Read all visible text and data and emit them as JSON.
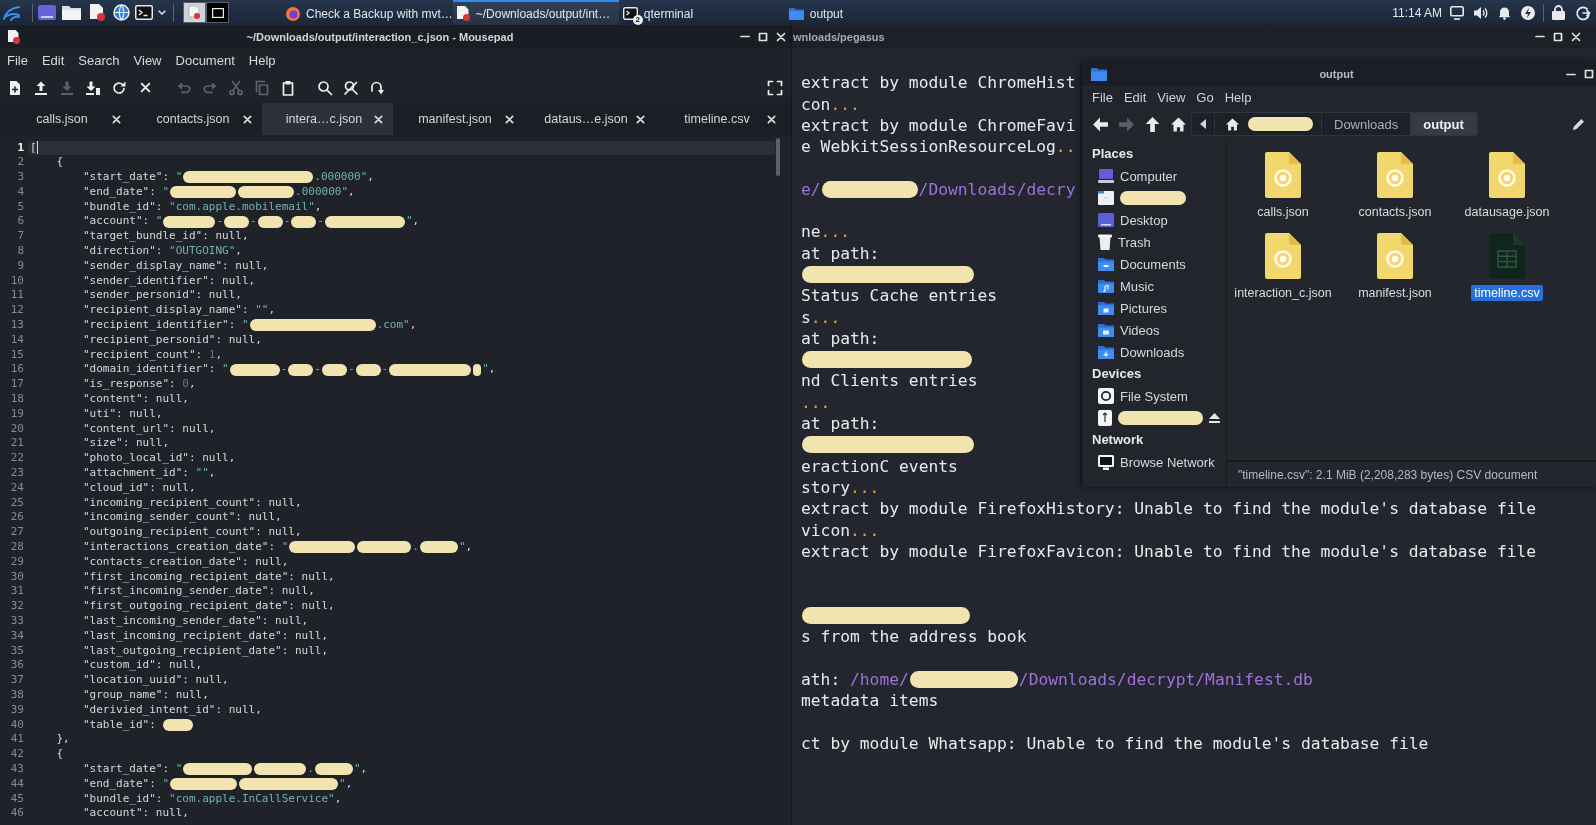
{
  "taskbar": {
    "workspaces": [
      {
        "selected": true
      },
      {
        "selected": false
      }
    ],
    "tasks": [
      {
        "kind": "browser",
        "label": "Check a Backup with mvt…",
        "selected": false
      },
      {
        "kind": "editor",
        "label": "~/Downloads/output/int…",
        "selected": true
      },
      {
        "kind": "terminal",
        "label": "qterminal",
        "badge": "2",
        "selected": false
      },
      {
        "kind": "files",
        "label": "output",
        "selected": false
      }
    ],
    "clock": "11:14 AM"
  },
  "editor_window": {
    "title": "~/Downloads/output/interaction_c.json - Mousepad",
    "menu": [
      "File",
      "Edit",
      "Search",
      "View",
      "Document",
      "Help"
    ],
    "toolbar": [
      [
        {
          "kind": "new",
          "disabled": false
        },
        {
          "kind": "open",
          "disabled": false
        },
        {
          "kind": "save",
          "disabled": true
        },
        {
          "kind": "save-as",
          "disabled": false
        },
        {
          "kind": "reload",
          "disabled": false
        },
        {
          "kind": "close",
          "disabled": false
        }
      ],
      [
        {
          "kind": "undo",
          "disabled": true
        },
        {
          "kind": "redo",
          "disabled": true
        }
      ],
      [
        {
          "kind": "cut",
          "disabled": true
        },
        {
          "kind": "copy",
          "disabled": true
        },
        {
          "kind": "paste",
          "disabled": false
        }
      ],
      [
        {
          "kind": "find",
          "disabled": false
        },
        {
          "kind": "replace",
          "disabled": false
        },
        {
          "kind": "goto",
          "disabled": false
        }
      ],
      [
        {
          "kind": "fullscreen",
          "disabled": false
        }
      ]
    ],
    "tabs": [
      {
        "label": "calls.json",
        "selected": false
      },
      {
        "label": "contacts.json",
        "selected": false
      },
      {
        "label": "intera…c.json",
        "selected": true
      },
      {
        "label": "manifest.json",
        "selected": false
      },
      {
        "label": "dataus…e.json",
        "selected": false
      },
      {
        "label": "timeline.csv",
        "selected": false
      }
    ],
    "lines": [
      {
        "number": "1",
        "current": true,
        "segments": [
          {
            "kind": "plain",
            "text": "["
          }
        ],
        "children": [
          {
            "number": "2",
            "current": false,
            "segments": [
              {
                "kind": "plain",
                "text": "{"
              }
            ],
            "children": [
              {
                "number": "3",
                "current": false,
                "segments": [
                  {
                    "kind": "plain",
                    "text": "\"start_date\": "
                  },
                  {
                    "kind": "string",
                    "text": "\""
                  },
                  {
                    "kind": "redacted"
                  },
                  {
                    "kind": "string",
                    "text": ".000000\""
                  },
                  {
                    "kind": "plain",
                    "text": ","
                  }
                ]
              },
              {
                "number": "4",
                "current": false,
                "segments": [
                  {
                    "kind": "plain",
                    "text": "\"end_date\": "
                  },
                  {
                    "kind": "string",
                    "text": "\""
                  },
                  {
                    "kind": "redacted"
                  },
                  {
                    "kind": "redacted"
                  },
                  {
                    "kind": "string",
                    "text": ".000000\""
                  },
                  {
                    "kind": "plain",
                    "text": ","
                  }
                ]
              },
              {
                "number": "5",
                "current": false,
                "segments": [
                  {
                    "kind": "plain",
                    "text": "\"bundle_id\": "
                  },
                  {
                    "kind": "string",
                    "text": "\"com.apple.mobilemail\""
                  },
                  {
                    "kind": "plain",
                    "text": ","
                  }
                ]
              },
              {
                "number": "6",
                "current": false,
                "segments": [
                  {
                    "kind": "plain",
                    "text": "\"account\": "
                  },
                  {
                    "kind": "string",
                    "text": "\""
                  },
                  {
                    "kind": "redacted"
                  },
                  {
                    "kind": "string",
                    "text": "-"
                  },
                  {
                    "kind": "redacted"
                  },
                  {
                    "kind": "string",
                    "text": "-"
                  },
                  {
                    "kind": "redacted"
                  },
                  {
                    "kind": "string",
                    "text": "-"
                  },
                  {
                    "kind": "redacted"
                  },
                  {
                    "kind": "string",
                    "text": "-"
                  },
                  {
                    "kind": "redacted"
                  },
                  {
                    "kind": "string",
                    "text": "\""
                  },
                  {
                    "kind": "plain",
                    "text": ","
                  }
                ]
              },
              {
                "number": "7",
                "current": false,
                "segments": [
                  {
                    "kind": "plain",
                    "text": "\"target_bundle_id\": null,"
                  }
                ]
              },
              {
                "number": "8",
                "current": false,
                "segments": [
                  {
                    "kind": "plain",
                    "text": "\"direction\": "
                  },
                  {
                    "kind": "string",
                    "text": "\"OUTGOING\""
                  },
                  {
                    "kind": "plain",
                    "text": ","
                  }
                ]
              },
              {
                "number": "9",
                "current": false,
                "segments": [
                  {
                    "kind": "plain",
                    "text": "\"sender_display_name\": null,"
                  }
                ]
              },
              {
                "number": "10",
                "current": false,
                "segments": [
                  {
                    "kind": "plain",
                    "text": "\"sender_identifier\": null,"
                  }
                ]
              },
              {
                "number": "11",
                "current": false,
                "segments": [
                  {
                    "kind": "plain",
                    "text": "\"sender_personid\": null,"
                  }
                ]
              },
              {
                "number": "12",
                "current": false,
                "segments": [
                  {
                    "kind": "plain",
                    "text": "\"recipient_display_name\": "
                  },
                  {
                    "kind": "string",
                    "text": "\"\""
                  },
                  {
                    "kind": "plain",
                    "text": ","
                  }
                ]
              },
              {
                "number": "13",
                "current": false,
                "segments": [
                  {
                    "kind": "plain",
                    "text": "\"recipient_identifier\": "
                  },
                  {
                    "kind": "string",
                    "text": "\""
                  },
                  {
                    "kind": "redacted"
                  },
                  {
                    "kind": "string",
                    "text": ".com\""
                  },
                  {
                    "kind": "plain",
                    "text": ","
                  }
                ]
              },
              {
                "number": "14",
                "current": false,
                "segments": [
                  {
                    "kind": "plain",
                    "text": "\"recipient_personid\": null,"
                  }
                ]
              },
              {
                "number": "15",
                "current": false,
                "segments": [
                  {
                    "kind": "plain",
                    "text": "\"recipient_count\": "
                  },
                  {
                    "kind": "number",
                    "text": "1"
                  },
                  {
                    "kind": "plain",
                    "text": ","
                  }
                ]
              },
              {
                "number": "16",
                "current": false,
                "segments": [
                  {
                    "kind": "plain",
                    "text": "\"domain_identifier\": "
                  },
                  {
                    "kind": "string",
                    "text": "\""
                  },
                  {
                    "kind": "redacted"
                  },
                  {
                    "kind": "string",
                    "text": "-"
                  },
                  {
                    "kind": "redacted"
                  },
                  {
                    "kind": "string",
                    "text": "-"
                  },
                  {
                    "kind": "redacted"
                  },
                  {
                    "kind": "string",
                    "text": "-"
                  },
                  {
                    "kind": "redacted"
                  },
                  {
                    "kind": "string",
                    "text": "-"
                  },
                  {
                    "kind": "redacted"
                  },
                  {
                    "kind": "redacted"
                  },
                  {
                    "kind": "string",
                    "text": "\""
                  },
                  {
                    "kind": "plain",
                    "text": ","
                  }
                ]
              },
              {
                "number": "17",
                "current": false,
                "segments": [
                  {
                    "kind": "plain",
                    "text": "\"is_response\": "
                  },
                  {
                    "kind": "number",
                    "text": "0"
                  },
                  {
                    "kind": "plain",
                    "text": ","
                  }
                ]
              },
              {
                "number": "18",
                "current": false,
                "segments": [
                  {
                    "kind": "plain",
                    "text": "\"content\": null,"
                  }
                ]
              },
              {
                "number": "19",
                "current": false,
                "segments": [
                  {
                    "kind": "plain",
                    "text": "\"uti\": null,"
                  }
                ]
              },
              {
                "number": "20",
                "current": false,
                "segments": [
                  {
                    "kind": "plain",
                    "text": "\"content_url\": null,"
                  }
                ]
              },
              {
                "number": "21",
                "current": false,
                "segments": [
                  {
                    "kind": "plain",
                    "text": "\"size\": null,"
                  }
                ]
              },
              {
                "number": "22",
                "current": false,
                "segments": [
                  {
                    "kind": "plain",
                    "text": "\"photo_local_id\": null,"
                  }
                ]
              },
              {
                "number": "23",
                "current": false,
                "segments": [
                  {
                    "kind": "plain",
                    "text": "\"attachment_id\": "
                  },
                  {
                    "kind": "string",
                    "text": "\"\""
                  },
                  {
                    "kind": "plain",
                    "text": ","
                  }
                ]
              },
              {
                "number": "24",
                "current": false,
                "segments": [
                  {
                    "kind": "plain",
                    "text": "\"cloud_id\": null,"
                  }
                ]
              },
              {
                "number": "25",
                "current": false,
                "segments": [
                  {
                    "kind": "plain",
                    "text": "\"incoming_recipient_count\": null,"
                  }
                ]
              },
              {
                "number": "26",
                "current": false,
                "segments": [
                  {
                    "kind": "plain",
                    "text": "\"incoming_sender_count\": null,"
                  }
                ]
              },
              {
                "number": "27",
                "current": false,
                "segments": [
                  {
                    "kind": "plain",
                    "text": "\"outgoing_recipient_count\": null,"
                  }
                ]
              },
              {
                "number": "28",
                "current": false,
                "segments": [
                  {
                    "kind": "plain",
                    "text": "\"interactions_creation_date\": "
                  },
                  {
                    "kind": "string",
                    "text": "\""
                  },
                  {
                    "kind": "redacted"
                  },
                  {
                    "kind": "redacted"
                  },
                  {
                    "kind": "string",
                    "text": "."
                  },
                  {
                    "kind": "redacted"
                  },
                  {
                    "kind": "string",
                    "text": "\""
                  },
                  {
                    "kind": "plain",
                    "text": ","
                  }
                ]
              },
              {
                "number": "29",
                "current": false,
                "segments": [
                  {
                    "kind": "plain",
                    "text": "\"contacts_creation_date\": null,"
                  }
                ]
              },
              {
                "number": "30",
                "current": false,
                "segments": [
                  {
                    "kind": "plain",
                    "text": "\"first_incoming_recipient_date\": null,"
                  }
                ]
              },
              {
                "number": "31",
                "current": false,
                "segments": [
                  {
                    "kind": "plain",
                    "text": "\"first_incoming_sender_date\": null,"
                  }
                ]
              },
              {
                "number": "32",
                "current": false,
                "segments": [
                  {
                    "kind": "plain",
                    "text": "\"first_outgoing_recipient_date\": null,"
                  }
                ]
              },
              {
                "number": "33",
                "current": false,
                "segments": [
                  {
                    "kind": "plain",
                    "text": "\"last_incoming_sender_date\": null,"
                  }
                ]
              },
              {
                "number": "34",
                "current": false,
                "segments": [
                  {
                    "kind": "plain",
                    "text": "\"last_incoming_recipient_date\": null,"
                  }
                ]
              },
              {
                "number": "35",
                "current": false,
                "segments": [
                  {
                    "kind": "plain",
                    "text": "\"last_outgoing_recipient_date\": null,"
                  }
                ]
              },
              {
                "number": "36",
                "current": false,
                "segments": [
                  {
                    "kind": "plain",
                    "text": "\"custom_id\": null,"
                  }
                ]
              },
              {
                "number": "37",
                "current": false,
                "segments": [
                  {
                    "kind": "plain",
                    "text": "\"location_uuid\": null,"
                  }
                ]
              },
              {
                "number": "38",
                "current": false,
                "segments": [
                  {
                    "kind": "plain",
                    "text": "\"group_name\": null,"
                  }
                ]
              },
              {
                "number": "39",
                "current": false,
                "segments": [
                  {
                    "kind": "plain",
                    "text": "\"derivied_intent_id\": null,"
                  }
                ]
              },
              {
                "number": "40",
                "current": false,
                "segments": [
                  {
                    "kind": "plain",
                    "text": "\"table_id\": "
                  },
                  {
                    "kind": "redacted"
                  }
                ]
              }
            ]
          },
          {
            "number": "41",
            "current": false,
            "segments": [
              {
                "kind": "plain",
                "text": "},"
              }
            ]
          },
          {
            "number": "42",
            "current": false,
            "segments": [
              {
                "kind": "plain",
                "text": "{"
              }
            ],
            "children": [
              {
                "number": "43",
                "current": false,
                "segments": [
                  {
                    "kind": "plain",
                    "text": "\"start_date\": "
                  },
                  {
                    "kind": "string",
                    "text": "\""
                  },
                  {
                    "kind": "redacted"
                  },
                  {
                    "kind": "redacted"
                  },
                  {
                    "kind": "string",
                    "text": "."
                  },
                  {
                    "kind": "redacted"
                  },
                  {
                    "kind": "string",
                    "text": "\""
                  },
                  {
                    "kind": "plain",
                    "text": ","
                  }
                ]
              },
              {
                "number": "44",
                "current": false,
                "segments": [
                  {
                    "kind": "plain",
                    "text": "\"end_date\": "
                  },
                  {
                    "kind": "string",
                    "text": "\""
                  },
                  {
                    "kind": "redacted"
                  },
                  {
                    "kind": "redacted"
                  },
                  {
                    "kind": "string",
                    "text": "\""
                  },
                  {
                    "kind": "plain",
                    "text": ","
                  }
                ]
              },
              {
                "number": "45",
                "current": false,
                "segments": [
                  {
                    "kind": "plain",
                    "text": "\"bundle_id\": "
                  },
                  {
                    "kind": "string",
                    "text": "\"com.apple.InCallService\""
                  },
                  {
                    "kind": "plain",
                    "text": ","
                  }
                ]
              },
              {
                "number": "46",
                "current": false,
                "segments": [
                  {
                    "kind": "plain",
                    "text": "\"account\": null,"
                  }
                ]
              }
            ]
          }
        ]
      }
    ]
  },
  "terminal_window": {
    "title": "wnloads/pegasus",
    "lines": [
      {
        "kind": "text",
        "segments": [
          {
            "kind": "plain",
            "text": "extract by module ChromeHist"
          }
        ]
      },
      {
        "kind": "text",
        "segments": [
          {
            "kind": "plain",
            "text": "con"
          },
          {
            "kind": "dots",
            "text": "..."
          }
        ]
      },
      {
        "kind": "text",
        "segments": [
          {
            "kind": "plain",
            "text": "extract by module ChromeFavi"
          }
        ]
      },
      {
        "kind": "text",
        "segments": [
          {
            "kind": "plain",
            "text": "e WebkitSessionResourceLog"
          },
          {
            "kind": "dots",
            "text": ".."
          }
        ]
      },
      {
        "kind": "blank"
      },
      {
        "kind": "text",
        "segments": [
          {
            "kind": "path",
            "text": "e/"
          },
          {
            "kind": "redacted"
          },
          {
            "kind": "path",
            "text": "/Downloads/decry"
          }
        ]
      },
      {
        "kind": "blank"
      },
      {
        "kind": "text",
        "segments": [
          {
            "kind": "plain",
            "text": "ne"
          },
          {
            "kind": "dots",
            "text": "..."
          }
        ]
      },
      {
        "kind": "text",
        "segments": [
          {
            "kind": "plain",
            "text": "at path:"
          }
        ]
      },
      {
        "kind": "text",
        "segments": [
          {
            "kind": "redacted"
          }
        ]
      },
      {
        "kind": "text",
        "segments": [
          {
            "kind": "plain",
            "text": "Status Cache entries"
          }
        ]
      },
      {
        "kind": "text",
        "segments": [
          {
            "kind": "plain",
            "text": "s"
          },
          {
            "kind": "dots",
            "text": "..."
          }
        ]
      },
      {
        "kind": "text",
        "segments": [
          {
            "kind": "plain",
            "text": "at path:"
          }
        ]
      },
      {
        "kind": "text",
        "segments": [
          {
            "kind": "redacted"
          }
        ]
      },
      {
        "kind": "text",
        "segments": [
          {
            "kind": "plain",
            "text": "nd Clients entries"
          }
        ]
      },
      {
        "kind": "text",
        "segments": [
          {
            "kind": "dots",
            "text": "..."
          }
        ]
      },
      {
        "kind": "text",
        "segments": [
          {
            "kind": "plain",
            "text": "at path:"
          }
        ]
      },
      {
        "kind": "text",
        "segments": [
          {
            "kind": "redacted"
          }
        ]
      },
      {
        "kind": "text",
        "segments": [
          {
            "kind": "plain",
            "text": "eractionC events"
          }
        ]
      },
      {
        "kind": "text",
        "segments": [
          {
            "kind": "plain",
            "text": "story"
          },
          {
            "kind": "dots",
            "text": "..."
          }
        ]
      },
      {
        "kind": "text",
        "segments": [
          {
            "kind": "plain",
            "text": "extract by module FirefoxHistory: Unable to find the module's database file"
          }
        ]
      },
      {
        "kind": "text",
        "segments": [
          {
            "kind": "plain",
            "text": "vicon"
          },
          {
            "kind": "dots",
            "text": "..."
          }
        ]
      },
      {
        "kind": "text",
        "segments": [
          {
            "kind": "plain",
            "text": "extract by module FirefoxFavicon: Unable to find the module's database file"
          }
        ]
      },
      {
        "kind": "blank"
      },
      {
        "kind": "blank"
      },
      {
        "kind": "text",
        "segments": [
          {
            "kind": "redacted"
          }
        ]
      },
      {
        "kind": "text",
        "segments": [
          {
            "kind": "plain",
            "text": "s from the address book"
          }
        ]
      },
      {
        "kind": "blank"
      },
      {
        "kind": "text",
        "segments": [
          {
            "kind": "plain",
            "text": "ath: "
          },
          {
            "kind": "path",
            "text": "/home/"
          },
          {
            "kind": "redacted"
          },
          {
            "kind": "path",
            "text": "/Downloads/decrypt/Manifest.db"
          }
        ]
      },
      {
        "kind": "text",
        "segments": [
          {
            "kind": "plain",
            "text": "metadata items"
          }
        ]
      },
      {
        "kind": "blank"
      },
      {
        "kind": "text",
        "segments": [
          {
            "kind": "plain",
            "text": "ct by module Whatsapp: Unable to find the module's database file"
          }
        ]
      }
    ]
  },
  "file_manager": {
    "title": "output",
    "menu": [
      "File",
      "Edit",
      "View",
      "Go",
      "Help"
    ],
    "nav": [
      {
        "kind": "back",
        "disabled": false
      },
      {
        "kind": "forward",
        "disabled": true
      },
      {
        "kind": "up",
        "disabled": false
      },
      {
        "kind": "home",
        "disabled": false
      }
    ],
    "path": [
      {
        "kind": "home",
        "selected": false
      },
      {
        "kind": "folder",
        "label": "Downloads",
        "selected": false
      },
      {
        "kind": "folder",
        "label": "output",
        "selected": true
      }
    ],
    "sidebar": [
      {
        "heading": "Places",
        "items": [
          {
            "kind": "computer",
            "label": "Computer",
            "redacted": false
          },
          {
            "kind": "home",
            "redacted": true
          },
          {
            "kind": "desktop",
            "label": "Desktop",
            "redacted": false
          },
          {
            "kind": "trash",
            "label": "Trash",
            "redacted": false
          },
          {
            "kind": "documents",
            "label": "Documents",
            "redacted": false
          },
          {
            "kind": "music",
            "label": "Music",
            "redacted": false
          },
          {
            "kind": "pictures",
            "label": "Pictures",
            "redacted": false
          },
          {
            "kind": "videos",
            "label": "Videos",
            "redacted": false
          },
          {
            "kind": "downloads",
            "label": "Downloads",
            "redacted": false
          }
        ]
      },
      {
        "heading": "Devices",
        "items": [
          {
            "kind": "filesystem",
            "label": "File System",
            "redacted": false
          },
          {
            "kind": "usb",
            "redacted": true
          }
        ]
      },
      {
        "heading": "Network",
        "items": [
          {
            "kind": "network",
            "label": "Browse Network",
            "redacted": false
          }
        ]
      }
    ],
    "files": [
      {
        "kind": "json",
        "name": "calls.json",
        "selected": false
      },
      {
        "kind": "json",
        "name": "contacts.json",
        "selected": false
      },
      {
        "kind": "json",
        "name": "datausage.json",
        "selected": false
      },
      {
        "kind": "json",
        "name": "interaction_c.json",
        "selected": false
      },
      {
        "kind": "json",
        "name": "manifest.json",
        "selected": false
      },
      {
        "kind": "spreadsheet",
        "name": "timeline.csv",
        "selected": true
      }
    ],
    "status": "\"timeline.csv\": 2.1 MiB (2,208,283 bytes) CSV document"
  }
}
